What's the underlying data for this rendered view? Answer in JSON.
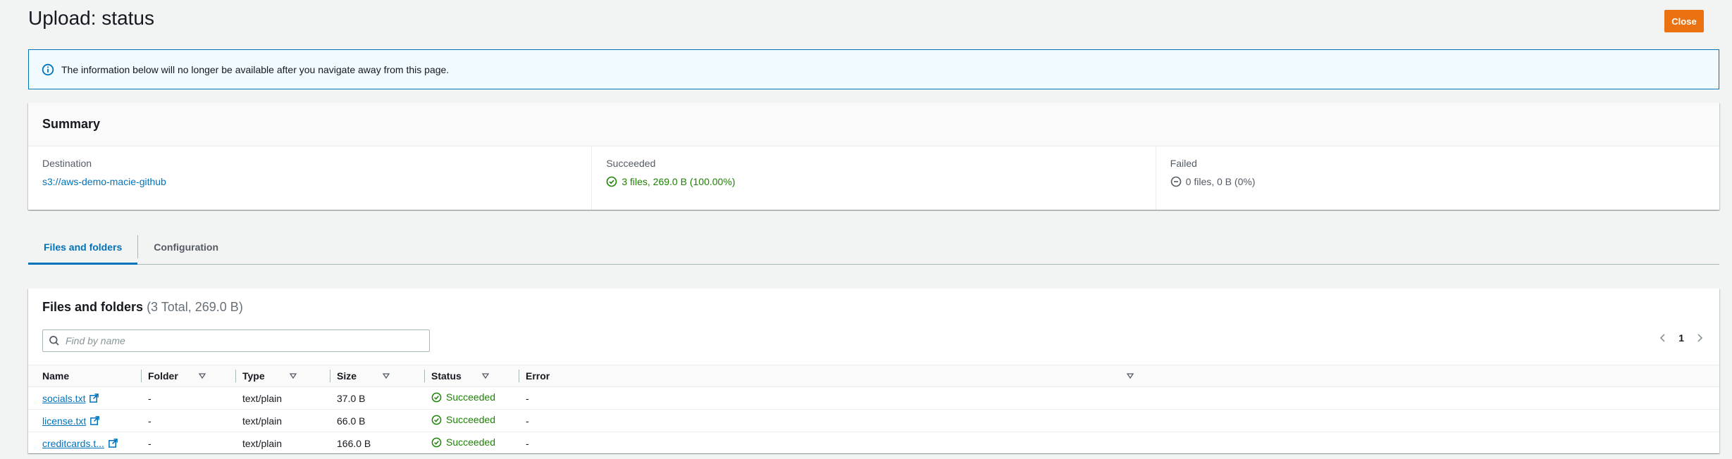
{
  "page": {
    "title": "Upload: status",
    "close_label": "Close"
  },
  "alert": {
    "text": "The information below will no longer be available after you navigate away from this page.",
    "icon": "info-icon"
  },
  "summary": {
    "title": "Summary",
    "destination": {
      "label": "Destination",
      "value": "s3://aws-demo-macie-github"
    },
    "succeeded": {
      "label": "Succeeded",
      "value": "3 files, 269.0 B (100.00%)",
      "icon": "check-circle-icon"
    },
    "failed": {
      "label": "Failed",
      "value": "0 files, 0 B (0%)",
      "icon": "minus-circle-icon"
    }
  },
  "tabs": [
    {
      "label": "Files and folders",
      "active": true
    },
    {
      "label": "Configuration",
      "active": false
    }
  ],
  "files": {
    "title": "Files and folders",
    "count": "(3 Total, 269.0 B)",
    "search_placeholder": "Find by name",
    "page": "1",
    "columns": [
      "Name",
      "Folder",
      "Type",
      "Size",
      "Status",
      "Error"
    ],
    "rows": [
      {
        "name": "socials.txt",
        "folder": "-",
        "type": "text/plain",
        "size": "37.0 B",
        "status": "Succeeded",
        "error": "-"
      },
      {
        "name": "license.txt",
        "folder": "-",
        "type": "text/plain",
        "size": "66.0 B",
        "status": "Succeeded",
        "error": "-"
      },
      {
        "name": "creditcards.t...",
        "folder": "-",
        "type": "text/plain",
        "size": "166.0 B",
        "status": "Succeeded",
        "error": "-"
      }
    ]
  },
  "colors": {
    "accent": "#0073bb",
    "primary_button": "#ec7211",
    "success": "#1d8102"
  }
}
